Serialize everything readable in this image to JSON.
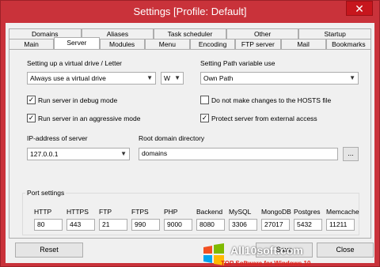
{
  "window": {
    "title": "Settings [Profile: Default]",
    "close_glyph": "✕"
  },
  "tabs_row1": [
    "Domains",
    "Aliases",
    "Task scheduler",
    "Other",
    "Startup"
  ],
  "tabs_row2": [
    "Main",
    "Server",
    "Modules",
    "Menu",
    "Encoding",
    "FTP server",
    "Mail",
    "Bookmarks"
  ],
  "active_tab": "Server",
  "server": {
    "virtual_drive_label": "Setting up a virtual drive / Letter",
    "virtual_drive_value": "Always use a virtual drive",
    "drive_letter": "W",
    "path_var_label": "Setting Path variable use",
    "path_var_value": "Own Path",
    "debug_mode": {
      "label": "Run server in debug mode",
      "checked": true
    },
    "aggressive_mode": {
      "label": "Run server in an aggressive mode",
      "checked": true
    },
    "hosts_file": {
      "label": "Do not make changes to the HOSTS file",
      "checked": false
    },
    "protect": {
      "label": "Protect server from external access",
      "checked": true
    },
    "ip_label": "IP-address of server",
    "ip_value": "127.0.0.1",
    "root_label": "Root domain directory",
    "root_value": "domains",
    "browse_label": "..."
  },
  "ports": {
    "group_title": "Port settings",
    "items": [
      {
        "label": "HTTP",
        "value": "80"
      },
      {
        "label": "HTTPS",
        "value": "443"
      },
      {
        "label": "FTP",
        "value": "21"
      },
      {
        "label": "FTPS",
        "value": "990"
      },
      {
        "label": "PHP",
        "value": "9000"
      },
      {
        "label": "Backend",
        "value": "8080"
      },
      {
        "label": "MySQL",
        "value": "3306"
      },
      {
        "label": "MongoDB",
        "value": "27017"
      },
      {
        "label": "Postgres",
        "value": "5432"
      },
      {
        "label": "Memcache",
        "value": "11211"
      }
    ]
  },
  "footer": {
    "reset_label": "Reset",
    "save_label": "Save",
    "close_label": "Close"
  },
  "watermark": {
    "site": "All10soft.com",
    "tagline": "TOP Software for Windows 10"
  },
  "colors": {
    "titlebar": "#c9323a",
    "close": "#c7161d"
  }
}
